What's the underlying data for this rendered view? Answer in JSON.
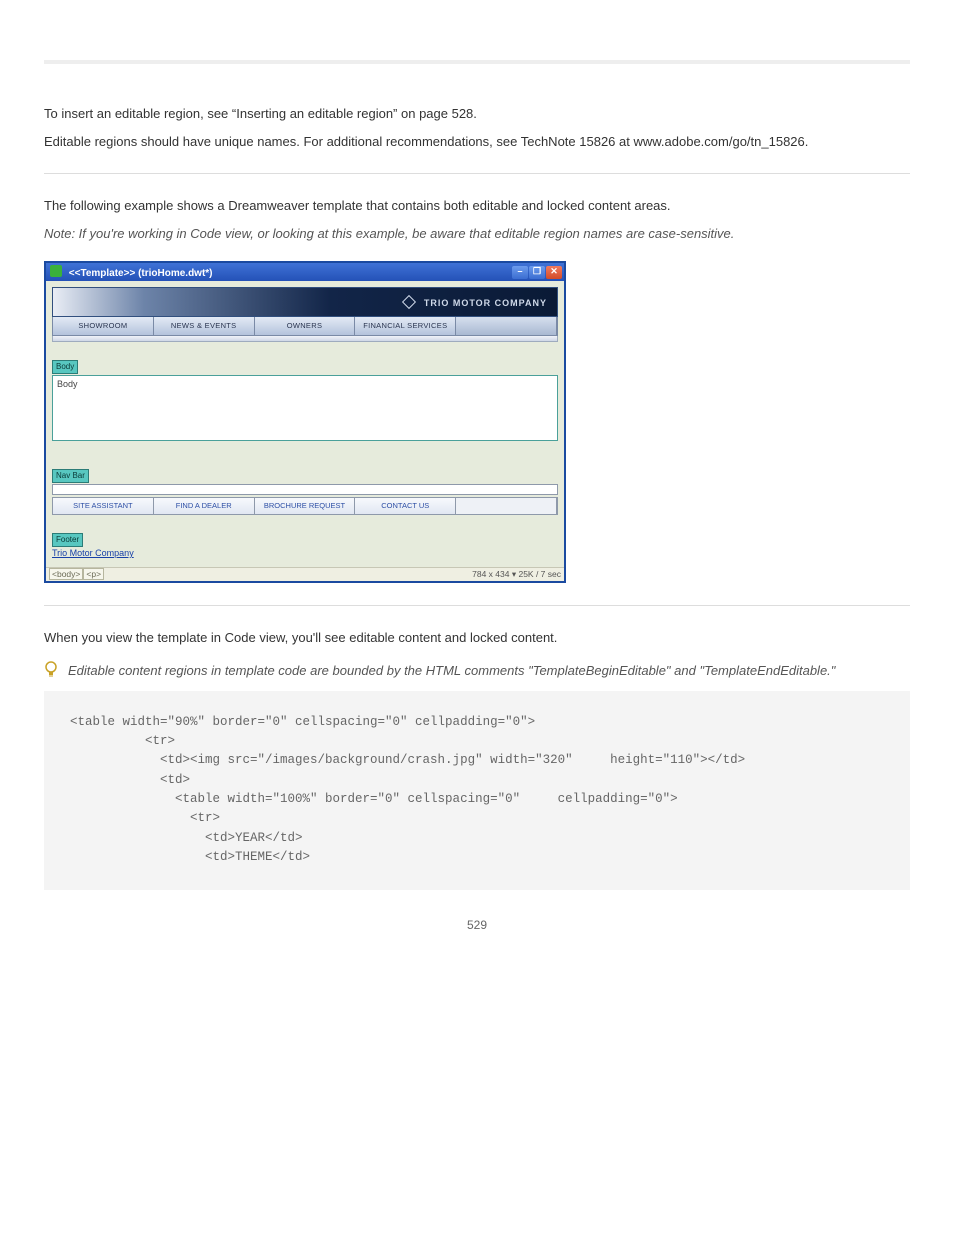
{
  "intro": {
    "p1": "To insert an editable region, see “Inserting an editable region” on page 528.",
    "p2": "Editable regions should have unique names. For additional recommendations, see TechNote 15826 at www.adobe.com/go/tn_15826."
  },
  "section1": {
    "p1": "The following example shows a Dreamweaver template that contains both editable and locked content areas.",
    "note": "Note: If you're working in Code view, or looking at this example, be aware that editable region names are case-sensitive."
  },
  "win": {
    "title": "<<Template>>  (trioHome.dwt*)",
    "brand": "TRIO MOTOR COMPANY",
    "nav_top": [
      "SHOWROOM",
      "NEWS & EVENTS",
      "OWNERS",
      "FINANCIAL SERVICES",
      ""
    ],
    "body_tag": "Body",
    "body_text": "Body",
    "navbar_tag": "Nav Bar",
    "nav_bottom": [
      "SITE ASSISTANT",
      "FIND A DEALER",
      "BROCHURE REQUEST",
      "CONTACT US",
      ""
    ],
    "footer_tag": "Footer",
    "footer_text": "Trio Motor Company",
    "tags": [
      "<body>",
      "<p>"
    ],
    "status": "784 x 434 ▾ 25K / 7 sec"
  },
  "section2": {
    "p1": "When you view the template in Code view, you'll see editable content and locked content.",
    "tip": "Editable content regions in template code are bounded by the HTML comments \"TemplateBeginEditable\" and \"TemplateEndEditable.\""
  },
  "code": "<table width=\"90%\" border=\"0\" cellspacing=\"0\" cellpadding=\"0\"> \n          <tr> \n            <td><img src=\"/images/background/crash.jpg\" width=\"320\"     height=\"110\"></td> \n            <td> \n              <table width=\"100%\" border=\"0\" cellspacing=\"0\"     cellpadding=\"0\"> \n                <tr> \n                  <td>YEAR</td> \n                  <td>THEME</td>",
  "page_number": "529"
}
